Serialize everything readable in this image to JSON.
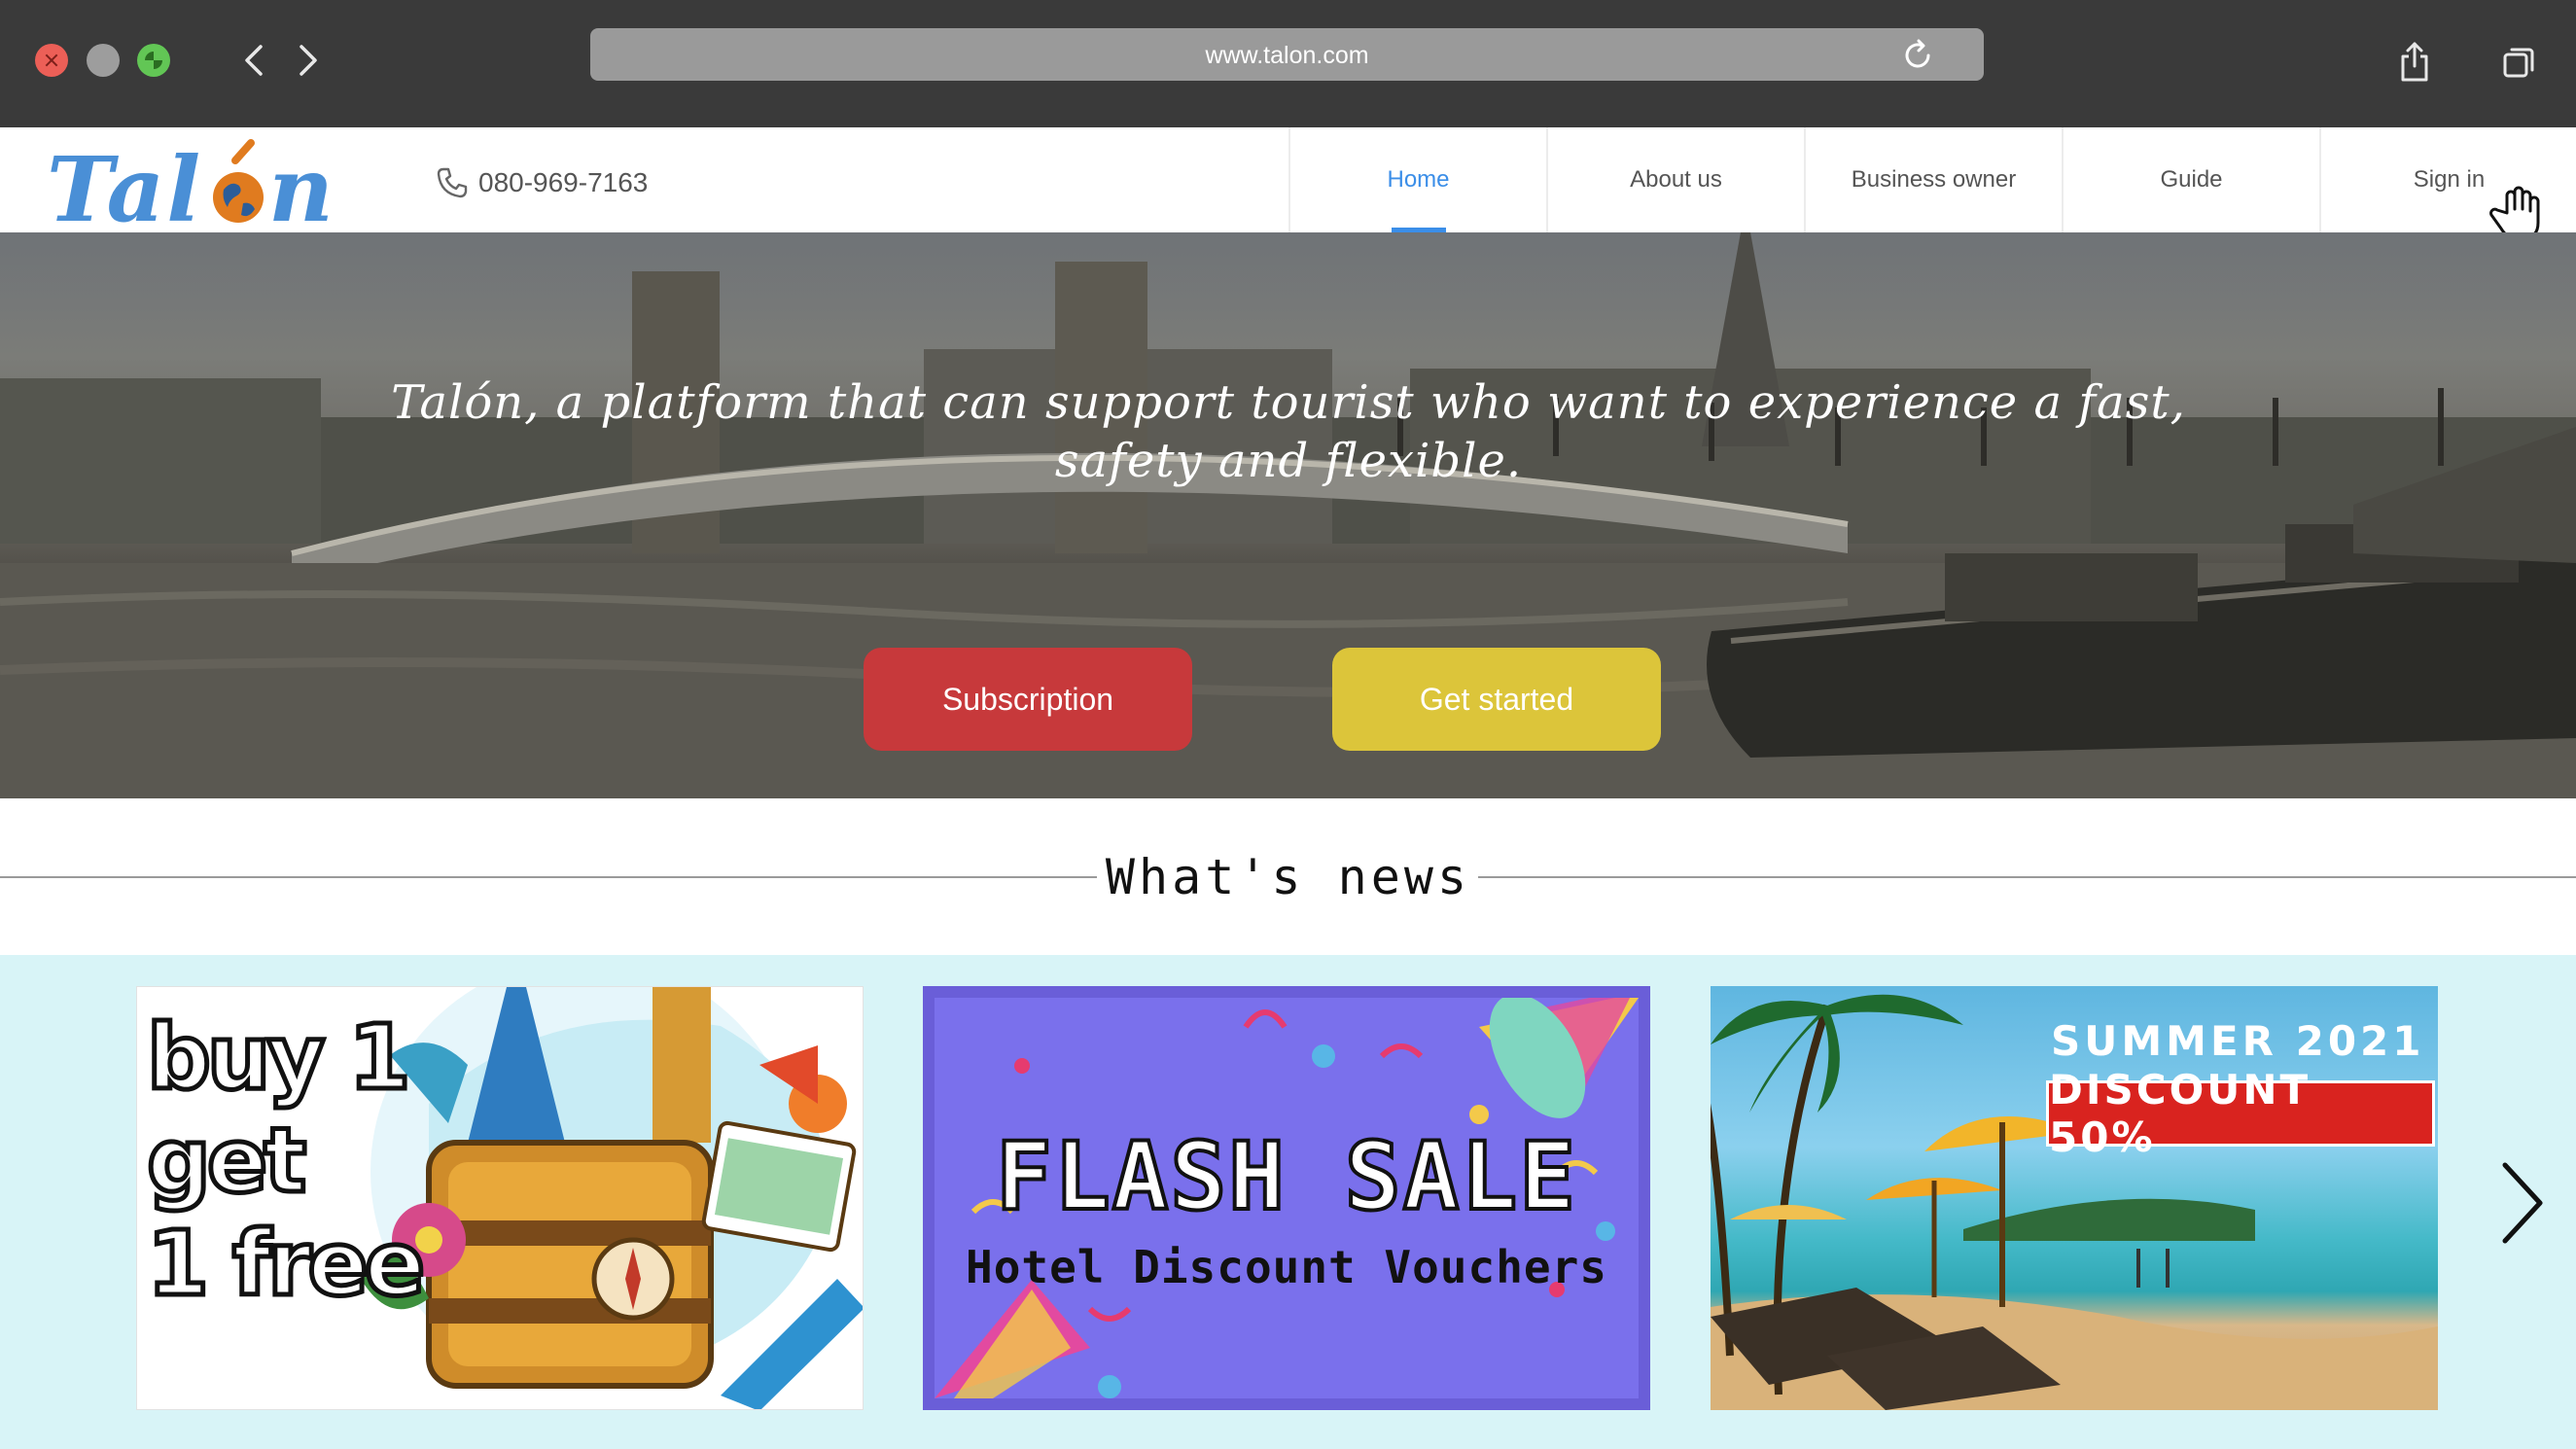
{
  "browser": {
    "url": "www.talon.com",
    "icons": [
      "close-icon",
      "minimize-icon",
      "fullscreen-icon",
      "back-icon",
      "forward-icon",
      "reload-icon",
      "share-icon",
      "tabs-icon"
    ]
  },
  "header": {
    "logo_text": "Talón",
    "phone": "080-969-7163",
    "nav": [
      {
        "label": "Home",
        "active": true
      },
      {
        "label": "About us",
        "active": false
      },
      {
        "label": "Business owner",
        "active": false
      },
      {
        "label": "Guide",
        "active": false
      },
      {
        "label": "Sign in",
        "active": false
      }
    ],
    "accent_color": "#3b8ee8"
  },
  "hero": {
    "headline": "Talón, a platform that can support tourist who want to experience a fast, safety and flexible.",
    "buttons": {
      "subscription": "Subscription",
      "get_started": "Get started"
    },
    "colors": {
      "subscription": "#c7393b",
      "get_started": "#dcc53a"
    }
  },
  "news": {
    "title": "What's news",
    "cards": [
      {
        "lines": [
          "buy 1",
          "get",
          "1 free"
        ]
      },
      {
        "title": "FLASH SALE",
        "subtitle": "Hotel Discount Vouchers"
      },
      {
        "title": "SUMMER 2021",
        "badge": "DISCOUNT 50%"
      }
    ]
  }
}
